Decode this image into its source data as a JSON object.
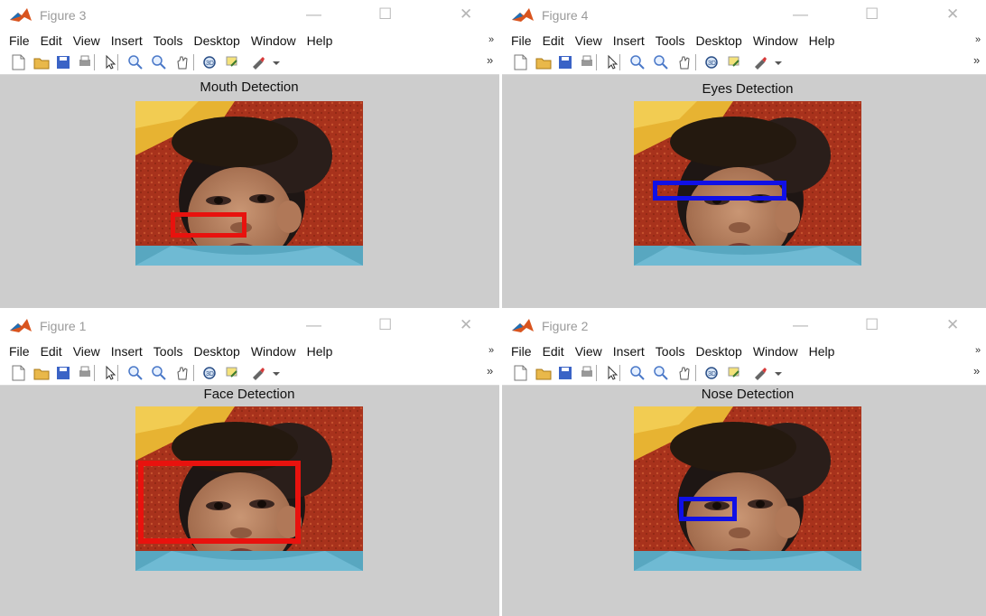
{
  "menu": [
    "File",
    "Edit",
    "View",
    "Insert",
    "Tools",
    "Desktop",
    "Window",
    "Help"
  ],
  "figures": [
    {
      "title": "Figure 3",
      "plot_title": "Mouth Detection"
    },
    {
      "title": "Figure 4",
      "plot_title": "Eyes Detection"
    },
    {
      "title": "Figure 1",
      "plot_title": "Face Detection"
    },
    {
      "title": "Figure 2",
      "plot_title": "Nose Detection"
    }
  ],
  "window_controls": {
    "minimize": "—",
    "maximize": "☐",
    "close": "✕"
  },
  "toolbar_icons": [
    "new-figure-icon",
    "open-file-icon",
    "save-icon",
    "print-icon",
    "pointer-icon",
    "zoom-in-icon",
    "zoom-out-icon",
    "pan-hand-icon",
    "rotate-3d-icon",
    "data-cursor-icon",
    "brush-icon",
    "brush-dropdown-icon"
  ],
  "toolbar_overflow": "»",
  "menu_overflow": "»",
  "colors": {
    "detection_red": "#e8120e",
    "detection_blue": "#1010e6",
    "figure_bg": "#cdcdcd"
  }
}
